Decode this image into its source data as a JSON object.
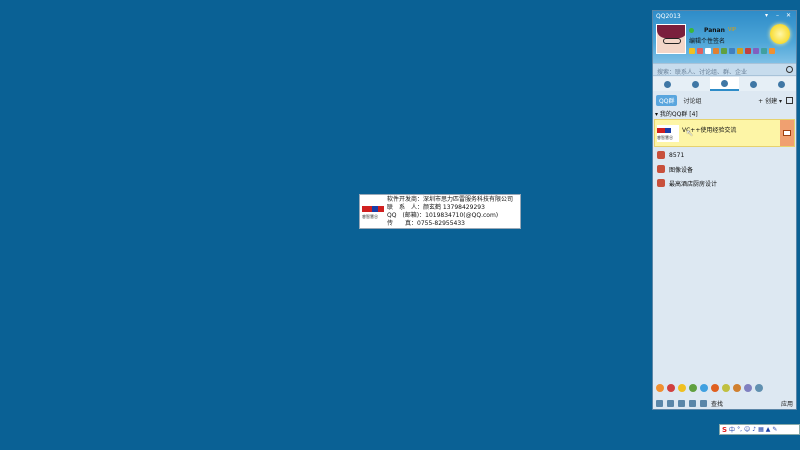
{
  "card": {
    "logo_caption": "睿智慧谷",
    "lines": [
      "软件开发商：深圳市思力匹雷服务科技有限公司",
      "联　系　人：颜玄鹤 13798429293",
      "QQ　(邮箱)：1019834710(@QQ.com)",
      "传　　真：0755-82955433"
    ]
  },
  "qq": {
    "title": "QQ2013",
    "nickname": "Panan",
    "vip_badge": "VIP",
    "signature": "编辑个性签名",
    "search_placeholder": "搜索：联系人、讨论组、群、企业",
    "sub_tabs": [
      "QQ群",
      "讨论组"
    ],
    "create_label": "+ 创建 ▾",
    "group_header": "▾ 我的QQ群 [4]",
    "groups": [
      {
        "name": "VC++使用经验交流",
        "logo_caption": "睿智慧谷"
      },
      {
        "name": "8571"
      },
      {
        "name": "图像设备"
      },
      {
        "name": "最高酒店厨房设计"
      }
    ],
    "find_label": "查找",
    "apps_label": "应用"
  },
  "ime": {
    "lang": "中"
  }
}
